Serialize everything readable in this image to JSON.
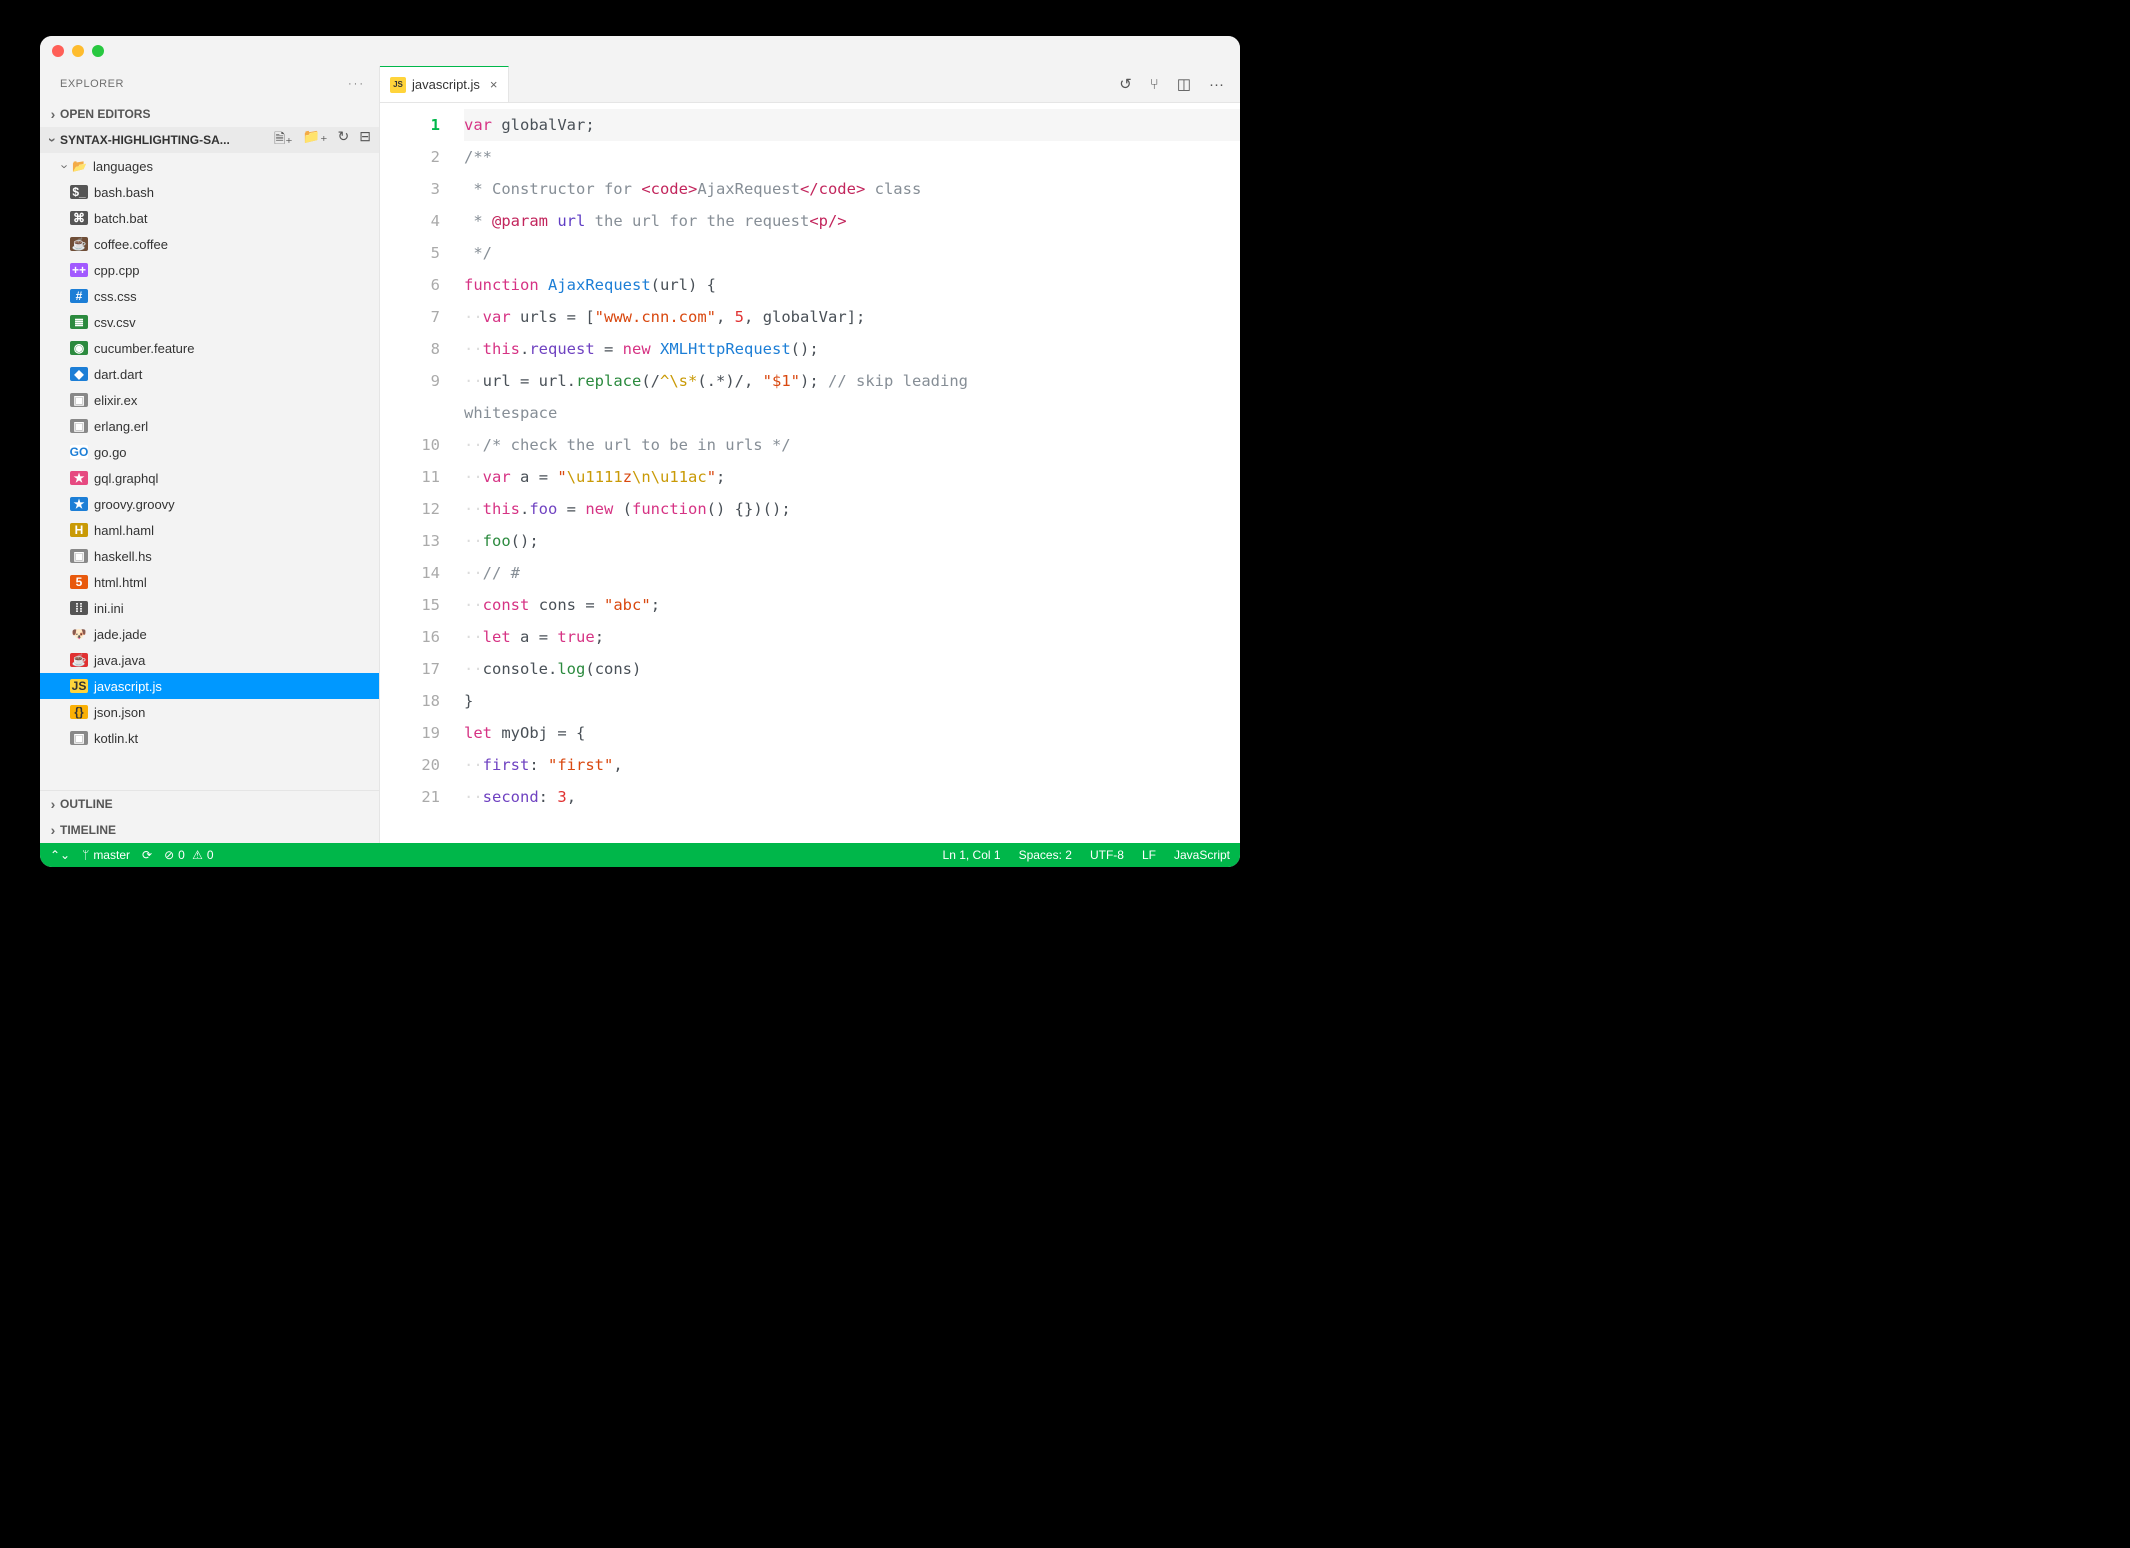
{
  "sidebar": {
    "title": "EXPLORER",
    "open_editors": "OPEN EDITORS",
    "project_name": "SYNTAX-HIGHLIGHTING-SA...",
    "folder": "languages",
    "outline": "OUTLINE",
    "timeline": "TIMELINE"
  },
  "files": [
    {
      "name": "bash.bash",
      "icon": "$_",
      "bg": "#555",
      "fg": "#fff"
    },
    {
      "name": "batch.bat",
      "icon": "⌘",
      "bg": "#555",
      "fg": "#fff"
    },
    {
      "name": "coffee.coffee",
      "icon": "☕",
      "bg": "#6f4e37",
      "fg": "#fff"
    },
    {
      "name": "cpp.cpp",
      "icon": "++",
      "bg": "#a259ff",
      "fg": "#fff"
    },
    {
      "name": "css.css",
      "icon": "#",
      "bg": "#1c7ed6",
      "fg": "#fff"
    },
    {
      "name": "csv.csv",
      "icon": "≣",
      "bg": "#2b8a3e",
      "fg": "#fff"
    },
    {
      "name": "cucumber.feature",
      "icon": "◉",
      "bg": "#2b8a3e",
      "fg": "#fff"
    },
    {
      "name": "dart.dart",
      "icon": "◆",
      "bg": "#1c7ed6",
      "fg": "#fff"
    },
    {
      "name": "elixir.ex",
      "icon": "▣",
      "bg": "#888",
      "fg": "#fff"
    },
    {
      "name": "erlang.erl",
      "icon": "▣",
      "bg": "#888",
      "fg": "#fff"
    },
    {
      "name": "go.go",
      "icon": "GO",
      "bg": "#fff",
      "fg": "#1c7ed6"
    },
    {
      "name": "gql.graphql",
      "icon": "★",
      "bg": "#e64980",
      "fg": "#fff"
    },
    {
      "name": "groovy.groovy",
      "icon": "★",
      "bg": "#1c7ed6",
      "fg": "#fff"
    },
    {
      "name": "haml.haml",
      "icon": "H",
      "bg": "#c99a06",
      "fg": "#fff"
    },
    {
      "name": "haskell.hs",
      "icon": "▣",
      "bg": "#888",
      "fg": "#fff"
    },
    {
      "name": "html.html",
      "icon": "5",
      "bg": "#e8590c",
      "fg": "#fff"
    },
    {
      "name": "ini.ini",
      "icon": "⁞⁞",
      "bg": "#555",
      "fg": "#fff"
    },
    {
      "name": "jade.jade",
      "icon": "🐶",
      "bg": "transparent",
      "fg": "#000"
    },
    {
      "name": "java.java",
      "icon": "☕",
      "bg": "#e03131",
      "fg": "#fff"
    },
    {
      "name": "javascript.js",
      "icon": "JS",
      "bg": "#ffd43b",
      "fg": "#333",
      "selected": true
    },
    {
      "name": "json.json",
      "icon": "{}",
      "bg": "#fab005",
      "fg": "#333"
    },
    {
      "name": "kotlin.kt",
      "icon": "▣",
      "bg": "#888",
      "fg": "#fff"
    }
  ],
  "tab": {
    "icon_text": "JS",
    "label": "javascript.js"
  },
  "code_lines": [
    [
      [
        "kw",
        "var"
      ],
      [
        "op",
        " "
      ],
      [
        "ident",
        "globalVar"
      ],
      [
        "op",
        ";"
      ]
    ],
    [
      [
        "cmt",
        "/**"
      ]
    ],
    [
      [
        "cmt",
        " * Constructor for "
      ],
      [
        "tag",
        "<code>"
      ],
      [
        "cmt",
        "AjaxRequest"
      ],
      [
        "tag",
        "</code>"
      ],
      [
        "cmt",
        " class"
      ]
    ],
    [
      [
        "cmt",
        " * "
      ],
      [
        "tag",
        "@param"
      ],
      [
        "op",
        " "
      ],
      [
        "param",
        "url"
      ],
      [
        "cmt",
        " the url for the request"
      ],
      [
        "tag",
        "<p/>"
      ]
    ],
    [
      [
        "cmt",
        " */"
      ]
    ],
    [
      [
        "kw",
        "function"
      ],
      [
        "op",
        " "
      ],
      [
        "type",
        "AjaxRequest"
      ],
      [
        "op",
        "("
      ],
      [
        "ident",
        "url"
      ],
      [
        "op",
        ") {"
      ]
    ],
    [
      [
        "ws",
        "··"
      ],
      [
        "kw",
        "var"
      ],
      [
        "op",
        " "
      ],
      [
        "ident",
        "urls"
      ],
      [
        "op",
        " = ["
      ],
      [
        "str",
        "\"www.cnn.com\""
      ],
      [
        "op",
        ", "
      ],
      [
        "num",
        "5"
      ],
      [
        "op",
        ", "
      ],
      [
        "ident",
        "globalVar"
      ],
      [
        "op",
        "];"
      ]
    ],
    [
      [
        "ws",
        "··"
      ],
      [
        "kw",
        "this"
      ],
      [
        "op",
        "."
      ],
      [
        "prop",
        "request"
      ],
      [
        "op",
        " = "
      ],
      [
        "kw",
        "new"
      ],
      [
        "op",
        " "
      ],
      [
        "type",
        "XMLHttpRequest"
      ],
      [
        "op",
        "();"
      ]
    ],
    [
      [
        "ws",
        "··"
      ],
      [
        "ident",
        "url"
      ],
      [
        "op",
        " = "
      ],
      [
        "ident",
        "url"
      ],
      [
        "op",
        "."
      ],
      [
        "fn",
        "replace"
      ],
      [
        "op",
        "(/"
      ],
      [
        "esc",
        "^\\s*"
      ],
      [
        "op",
        "(.*)/, "
      ],
      [
        "str",
        "\"$1\""
      ],
      [
        "op",
        "); "
      ],
      [
        "cmt",
        "// skip leading"
      ]
    ],
    [
      [
        "cmt",
        "whitespace"
      ]
    ],
    [
      [
        "ws",
        "··"
      ],
      [
        "cmt",
        "/* check the url to be in urls */"
      ]
    ],
    [
      [
        "ws",
        "··"
      ],
      [
        "kw",
        "var"
      ],
      [
        "op",
        " "
      ],
      [
        "ident",
        "a"
      ],
      [
        "op",
        " = "
      ],
      [
        "str",
        "\""
      ],
      [
        "esc",
        "\\u1111"
      ],
      [
        "str",
        "z"
      ],
      [
        "esc",
        "\\n\\u11ac"
      ],
      [
        "str",
        "\""
      ],
      [
        "op",
        ";"
      ]
    ],
    [
      [
        "ws",
        "··"
      ],
      [
        "kw",
        "this"
      ],
      [
        "op",
        "."
      ],
      [
        "prop",
        "foo"
      ],
      [
        "op",
        " = "
      ],
      [
        "kw",
        "new"
      ],
      [
        "op",
        " ("
      ],
      [
        "kw",
        "function"
      ],
      [
        "op",
        "() {})();"
      ]
    ],
    [
      [
        "ws",
        "··"
      ],
      [
        "fn",
        "foo"
      ],
      [
        "op",
        "();"
      ]
    ],
    [
      [
        "ws",
        "··"
      ],
      [
        "cmt",
        "// #"
      ]
    ],
    [
      [
        "ws",
        "··"
      ],
      [
        "kw",
        "const"
      ],
      [
        "op",
        " "
      ],
      [
        "ident",
        "cons"
      ],
      [
        "op",
        " = "
      ],
      [
        "str",
        "\"abc\""
      ],
      [
        "op",
        ";"
      ]
    ],
    [
      [
        "ws",
        "··"
      ],
      [
        "kw",
        "let"
      ],
      [
        "op",
        " "
      ],
      [
        "ident",
        "a"
      ],
      [
        "op",
        " = "
      ],
      [
        "kw",
        "true"
      ],
      [
        "op",
        ";"
      ]
    ],
    [
      [
        "ws",
        "··"
      ],
      [
        "ident",
        "console"
      ],
      [
        "op",
        "."
      ],
      [
        "fn",
        "log"
      ],
      [
        "op",
        "("
      ],
      [
        "ident",
        "cons"
      ],
      [
        "op",
        ")"
      ]
    ],
    [
      [
        "op",
        "}"
      ]
    ],
    [
      [
        "kw",
        "let"
      ],
      [
        "op",
        " "
      ],
      [
        "ident",
        "myObj"
      ],
      [
        "op",
        " = {"
      ]
    ],
    [
      [
        "ws",
        "··"
      ],
      [
        "prop",
        "first"
      ],
      [
        "op",
        ": "
      ],
      [
        "str",
        "\"first\""
      ],
      [
        "op",
        ","
      ]
    ],
    [
      [
        "ws",
        "··"
      ],
      [
        "prop",
        "second"
      ],
      [
        "op",
        ": "
      ],
      [
        "num",
        "3"
      ],
      [
        "op",
        ","
      ]
    ]
  ],
  "gutter_numbers": [
    "1",
    "2",
    "3",
    "4",
    "5",
    "6",
    "7",
    "8",
    "9",
    "10",
    "11",
    "12",
    "13",
    "14",
    "15",
    "16",
    "17",
    "18",
    "19",
    "20",
    "21"
  ],
  "status": {
    "branch": "master",
    "errors": "0",
    "warnings": "0",
    "cursor": "Ln 1, Col 1",
    "spaces": "Spaces: 2",
    "encoding": "UTF-8",
    "eol": "LF",
    "lang": "JavaScript"
  }
}
